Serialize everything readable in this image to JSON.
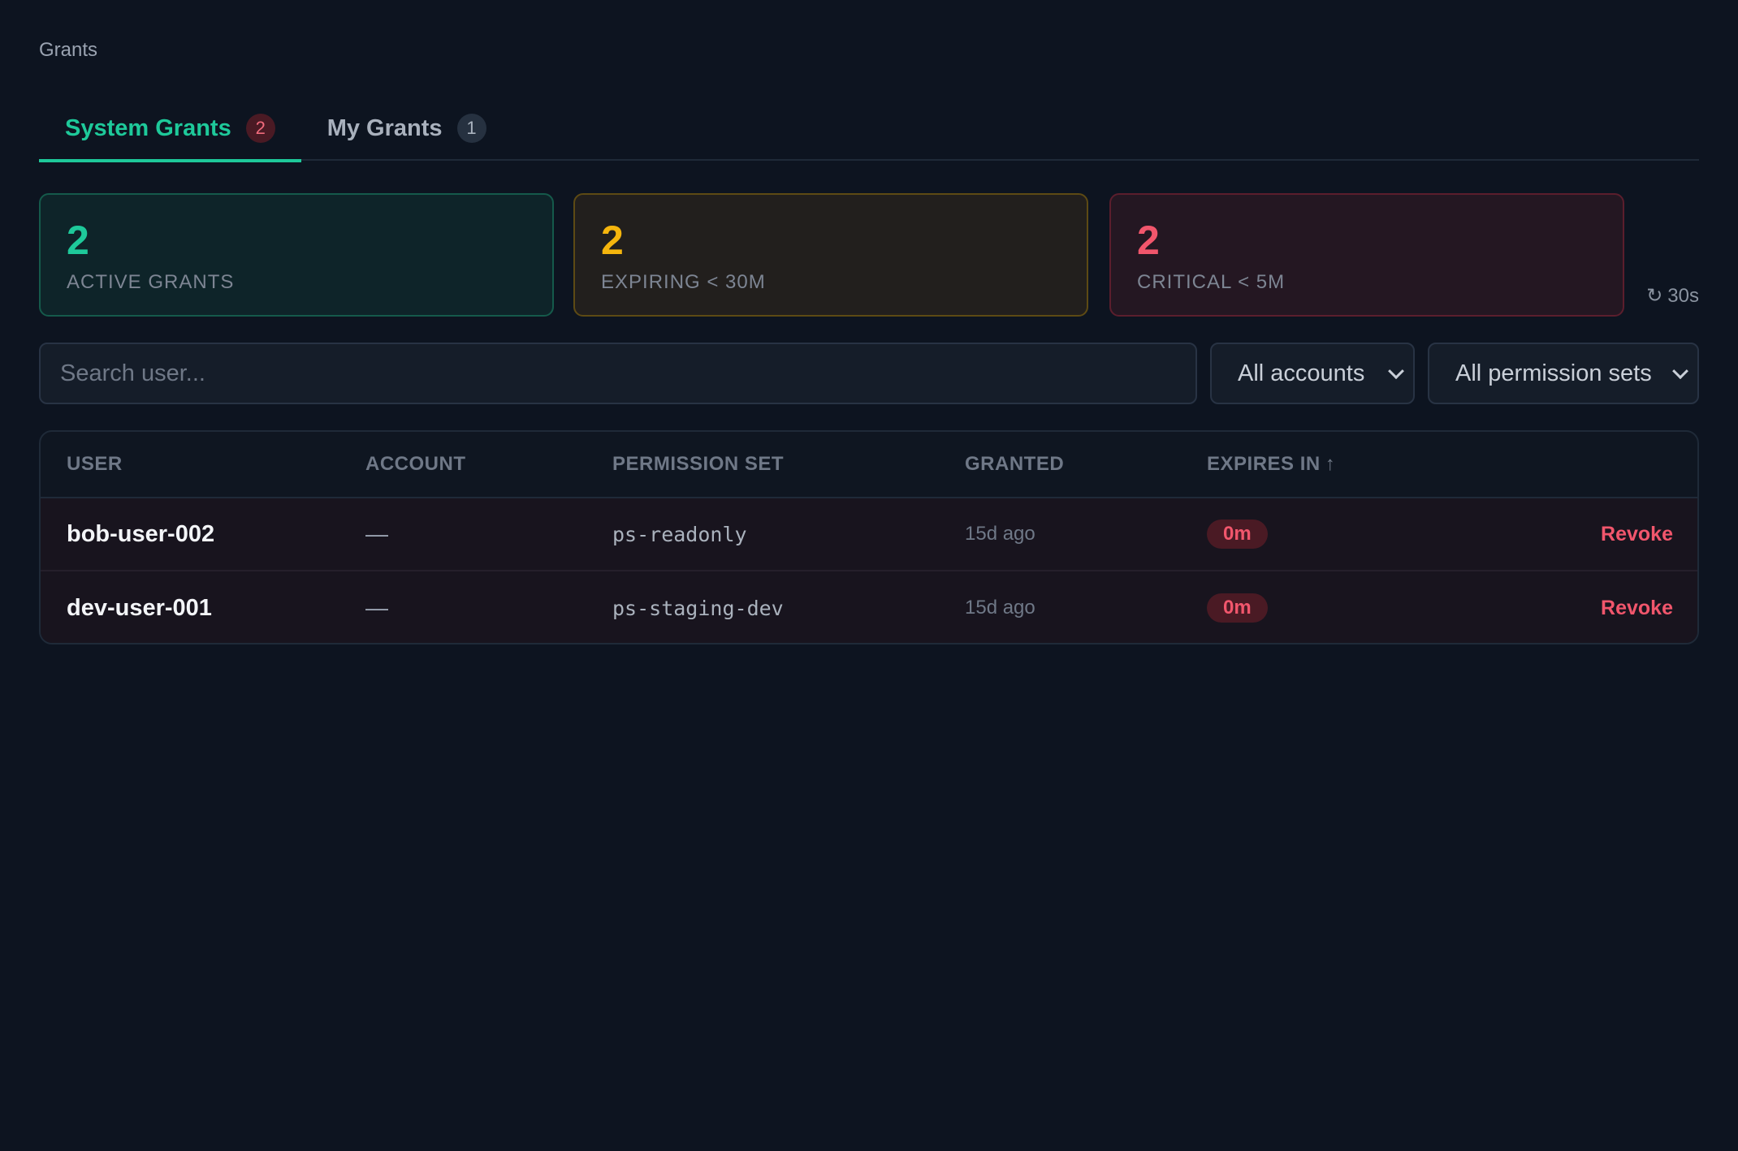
{
  "breadcrumb": "Grants",
  "tabs": [
    {
      "label": "System Grants",
      "count": "2"
    },
    {
      "label": "My Grants",
      "count": "1"
    }
  ],
  "stats": [
    {
      "value": "2",
      "label": "ACTIVE GRANTS"
    },
    {
      "value": "2",
      "label": "EXPIRING < 30M"
    },
    {
      "value": "2",
      "label": "CRITICAL < 5M"
    }
  ],
  "refresh": {
    "icon": "refresh-icon",
    "glyph": "↻",
    "label": "30s"
  },
  "filters": {
    "search_placeholder": "Search user...",
    "account_select": "All accounts",
    "permission_select": "All permission sets"
  },
  "table": {
    "headers": [
      "USER",
      "ACCOUNT",
      "PERMISSION SET",
      "GRANTED",
      "EXPIRES IN"
    ],
    "sort_indicator": "↑",
    "rows": [
      {
        "user": "bob-user-002",
        "account": "—",
        "permission_set": "ps-readonly",
        "granted": "15d ago",
        "expires": "0m",
        "action": "Revoke"
      },
      {
        "user": "dev-user-001",
        "account": "—",
        "permission_set": "ps-staging-dev",
        "granted": "15d ago",
        "expires": "0m",
        "action": "Revoke"
      }
    ]
  },
  "colors": {
    "accent": "#1ec99a",
    "warning": "#f5b50d",
    "danger": "#f1566c",
    "background": "#0d1420"
  }
}
